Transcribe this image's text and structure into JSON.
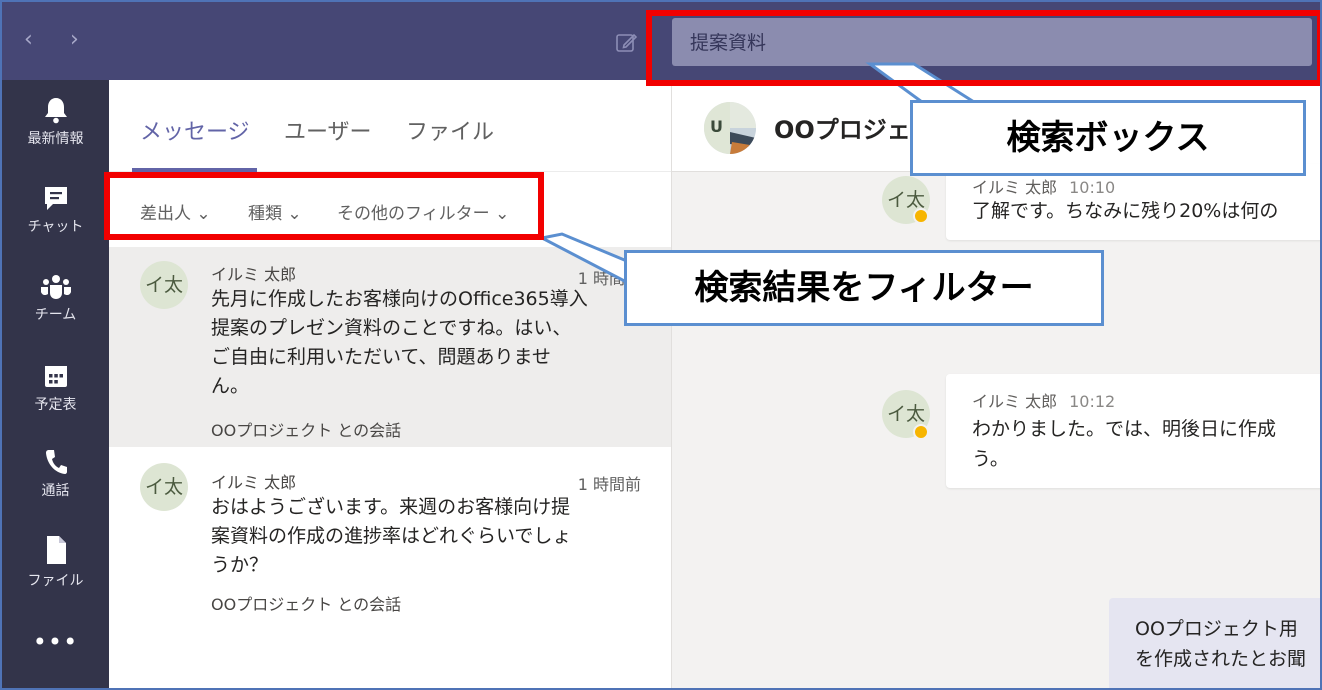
{
  "search": {
    "value": "提案資料"
  },
  "rail": {
    "items": [
      {
        "label": "最新情報",
        "icon": "bell-icon"
      },
      {
        "label": "チャット",
        "icon": "chat-icon"
      },
      {
        "label": "チーム",
        "icon": "teams-icon"
      },
      {
        "label": "予定表",
        "icon": "calendar-icon"
      },
      {
        "label": "通話",
        "icon": "phone-icon"
      },
      {
        "label": "ファイル",
        "icon": "file-icon"
      }
    ],
    "more": "•••"
  },
  "tabs": [
    "メッセージ",
    "ユーザー",
    "ファイル"
  ],
  "filters": [
    "差出人",
    "種類",
    "その他のフィルター"
  ],
  "results": [
    {
      "avatar": "イ太",
      "name": "イルミ 太郎",
      "time": "1 時間前",
      "lines": [
        "先月に作成したお客様向けのOffice365導入",
        "提案のプレゼン資料のことですね。はい、",
        "ご自由に利用いただいて、問題ありませ",
        "ん。"
      ],
      "conversation": "OOプロジェクト との会話"
    },
    {
      "avatar": "イ太",
      "name": "イルミ 太郎",
      "time": "1 時間前",
      "lines": [
        "おはようございます。来週のお客様向け提",
        "案資料の作成の進捗率はどれぐらいでしょ",
        "うか？"
      ],
      "conversation": "OOプロジェクト との会話"
    }
  ],
  "chat": {
    "title": "OOプロジェクト",
    "group_avatar_letter": "U",
    "messages": [
      {
        "avatar": "イ太",
        "name": "イルミ 太郎",
        "time": "10:10",
        "lines": [
          "了解です。ちなみに残り20%は何の"
        ]
      },
      {
        "avatar": "イ太",
        "name": "イルミ 太郎",
        "time": "10:12",
        "lines": [
          "わかりました。では、明後日に作成",
          "う。"
        ]
      }
    ],
    "own_message": {
      "lines": [
        "OOプロジェクト用",
        "を作成されたとお聞"
      ]
    }
  },
  "annotations": {
    "search_box_label": "検索ボックス",
    "filter_label": "検索結果をフィルター"
  },
  "colors": {
    "topbar": "#464775",
    "rail": "#33344a",
    "accent": "#6264a7",
    "highlight": "#f20000",
    "callout_border": "#5b8fd0",
    "status": "#f7b500"
  }
}
